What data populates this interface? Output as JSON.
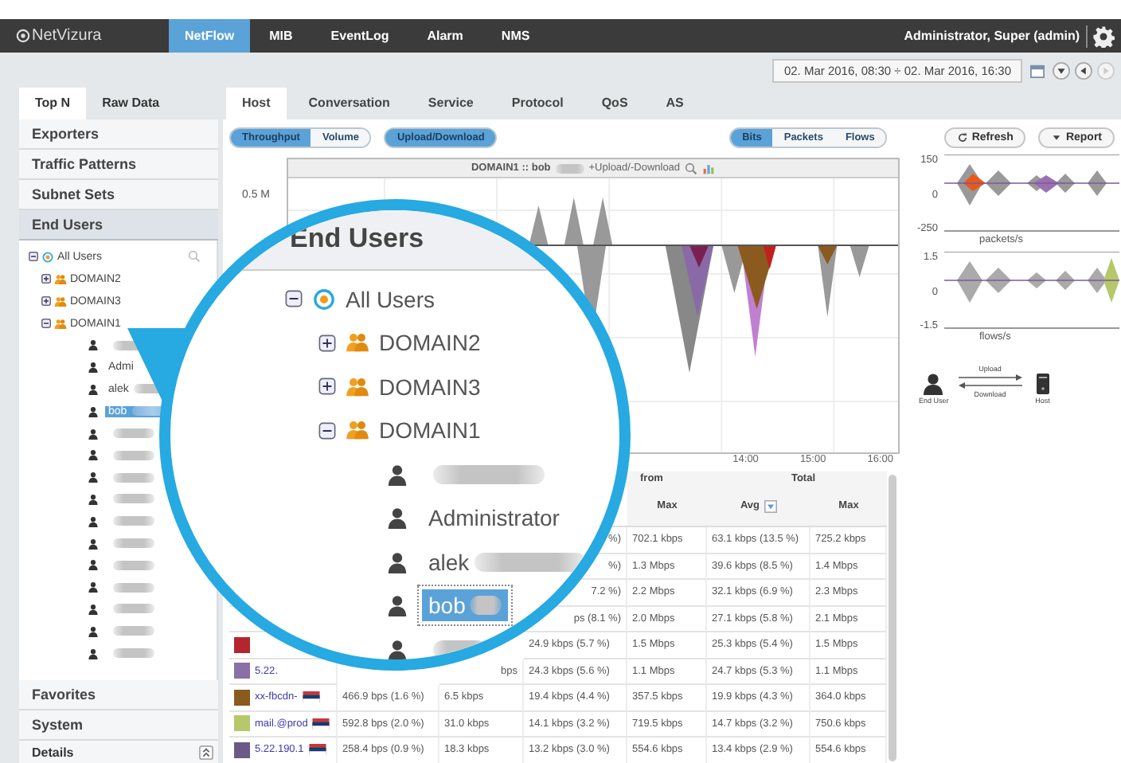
{
  "top_bar": {
    "logo": "NetVizura",
    "modules": [
      {
        "label": "NetFlow",
        "selected": true
      },
      {
        "label": "MIB",
        "selected": false
      },
      {
        "label": "EventLog",
        "selected": false
      },
      {
        "label": "Alarm",
        "selected": false
      },
      {
        "label": "NMS",
        "selected": false
      }
    ],
    "user": "Administrator, Super (admin)"
  },
  "time_range": {
    "value": "02. Mar 2016, 08:30 ÷ 02. Mar 2016, 16:30"
  },
  "sidebar": {
    "tabs": [
      {
        "label": "Top N",
        "selected": true
      },
      {
        "label": "Raw Data",
        "selected": false
      }
    ],
    "sections": [
      {
        "label": "Exporters",
        "expanded": false
      },
      {
        "label": "Traffic Patterns",
        "expanded": false
      },
      {
        "label": "Subnet Sets",
        "expanded": false
      },
      {
        "label": "End Users",
        "expanded": true
      },
      {
        "label": "Favorites",
        "expanded": false
      },
      {
        "label": "System",
        "expanded": false
      }
    ],
    "tree": {
      "label": "All Users",
      "expanded": true,
      "children": [
        {
          "label": "DOMAIN2",
          "expanded": false
        },
        {
          "label": "DOMAIN3",
          "expanded": false
        },
        {
          "label": "DOMAIN1",
          "expanded": true,
          "children": [
            {
              "redacted": true,
              "selected": false
            },
            {
              "name": "Admi",
              "redacted": false,
              "selected": false
            },
            {
              "name": "alek",
              "redacted": true,
              "selected": false
            },
            {
              "name": "bob",
              "redacted": true,
              "selected": true
            },
            {
              "redacted": true,
              "selected": false
            },
            {
              "redacted": true,
              "selected": false
            },
            {
              "redacted": true,
              "selected": false
            },
            {
              "redacted": true,
              "selected": false
            },
            {
              "redacted": true,
              "selected": false
            },
            {
              "redacted": true,
              "selected": false
            },
            {
              "redacted": true,
              "selected": false
            },
            {
              "redacted": true,
              "selected": false
            },
            {
              "redacted": true,
              "selected": false
            },
            {
              "redacted": true,
              "selected": false
            },
            {
              "redacted": true,
              "selected": false
            }
          ]
        }
      ]
    },
    "details": {
      "label": "Details"
    }
  },
  "main_tabs": [
    {
      "label": "Host",
      "selected": true
    },
    {
      "label": "Conversation",
      "selected": false
    },
    {
      "label": "Service",
      "selected": false
    },
    {
      "label": "Protocol",
      "selected": false
    },
    {
      "label": "QoS",
      "selected": false
    },
    {
      "label": "AS",
      "selected": false
    }
  ],
  "toolbar": {
    "view": [
      {
        "label": "Throughput",
        "selected": true
      },
      {
        "label": "Volume",
        "selected": false
      }
    ],
    "direction": {
      "label": "Upload/Download",
      "selected": true
    },
    "units": [
      {
        "label": "Bits",
        "selected": true
      },
      {
        "label": "Packets",
        "selected": false
      },
      {
        "label": "Flows",
        "selected": false
      }
    ],
    "actions": [
      {
        "label": "Refresh",
        "kind": "refresh"
      },
      {
        "label": "Report",
        "kind": "menu"
      }
    ]
  },
  "chart": {
    "title": "DOMAIN1 :: bob",
    "title_redacted": true,
    "title_suffix": "+Upload/-Download",
    "y_label": "0.5 M",
    "x_labels": [
      "14:00",
      "15:00",
      "16:00"
    ]
  },
  "table": {
    "group_headers": [
      "from",
      "Total"
    ],
    "columns": [
      "",
      "",
      "",
      "Max",
      "Avg",
      "Max"
    ],
    "rows": [
      {
        "cells": [
          null,
          null,
          "%)",
          "702.1 kbps",
          "63.1 kbps (13.5 %)",
          "725.2 kbps"
        ]
      },
      {
        "cells": [
          null,
          null,
          "%)",
          "1.3 Mbps",
          "39.6 kbps (8.5 %)",
          "1.4 Mbps"
        ]
      },
      {
        "cells": [
          null,
          null,
          "7.2 %)",
          "2.2 Mbps",
          "32.1 kbps (6.9 %)",
          "2.3 Mbps"
        ]
      },
      {
        "cells": [
          null,
          null,
          "ps (8.1 %)",
          "2.0 Mbps",
          "27.1 kbps (5.8 %)",
          "2.1 Mbps"
        ]
      },
      {
        "color": "#b3262e",
        "cells": [
          null,
          null,
          "24.9 kbps (5.7 %)",
          "1.5 Mbps",
          "25.3 kbps (5.4 %)",
          "1.5 Mbps"
        ]
      },
      {
        "color": "#8a70a6",
        "host": "5.22.",
        "cells": [
          null,
          "bps",
          "24.3 kbps (5.6 %)",
          "1.1 Mbps",
          "24.7 kbps (5.3 %)",
          "1.1 Mbps"
        ]
      },
      {
        "color": "#8a5a1e",
        "host": "xx-fbcdn-",
        "flag": true,
        "cells": [
          "466.9 bps (1.6 %)",
          "6.5 kbps",
          "19.4 kbps (4.4 %)",
          "357.5 kbps",
          "19.9 kbps (4.3 %)",
          "364.0 kbps"
        ]
      },
      {
        "color": "#b6c86a",
        "host": "mail.@prod",
        "flag": true,
        "cells": [
          "592.8 bps (2.0 %)",
          "31.0 kbps",
          "14.1 kbps (3.2 %)",
          "719.5 kbps",
          "14.7 kbps (3.2 %)",
          "750.6 kbps"
        ]
      },
      {
        "color": "#6b5a86",
        "host": "5.22.190.1",
        "flag": true,
        "cells": [
          "258.4 bps (0.9 %)",
          "18.3 kbps",
          "13.2 kbps (3.0 %)",
          "554.6 kbps",
          "13.4 kbps (2.9 %)",
          "554.6 kbps"
        ]
      }
    ]
  },
  "mini_charts": [
    {
      "xlabel": "packets/s",
      "yticks": [
        "150",
        "0",
        "-250"
      ]
    },
    {
      "xlabel": "flows/s",
      "yticks": [
        "1.5",
        "0",
        "-1.5"
      ]
    }
  ],
  "legend": {
    "source": "End User",
    "upload": "Upload",
    "download": "Download",
    "target": "Host"
  },
  "magnifier": {
    "title": "End Users",
    "root": {
      "label": "All Users",
      "expanded": true
    },
    "groups": [
      {
        "label": "DOMAIN2",
        "expanded": false
      },
      {
        "label": "DOMAIN3",
        "expanded": false
      },
      {
        "label": "DOMAIN1",
        "expanded": true
      }
    ],
    "users": [
      {
        "redacted": true,
        "selected": false
      },
      {
        "name": "Administrator",
        "redacted": false,
        "selected": false
      },
      {
        "name": "alek",
        "redacted": true,
        "selected": false
      },
      {
        "name": "bob",
        "redacted": true,
        "selected": true
      },
      {
        "redacted": true,
        "selected": false
      }
    ]
  }
}
